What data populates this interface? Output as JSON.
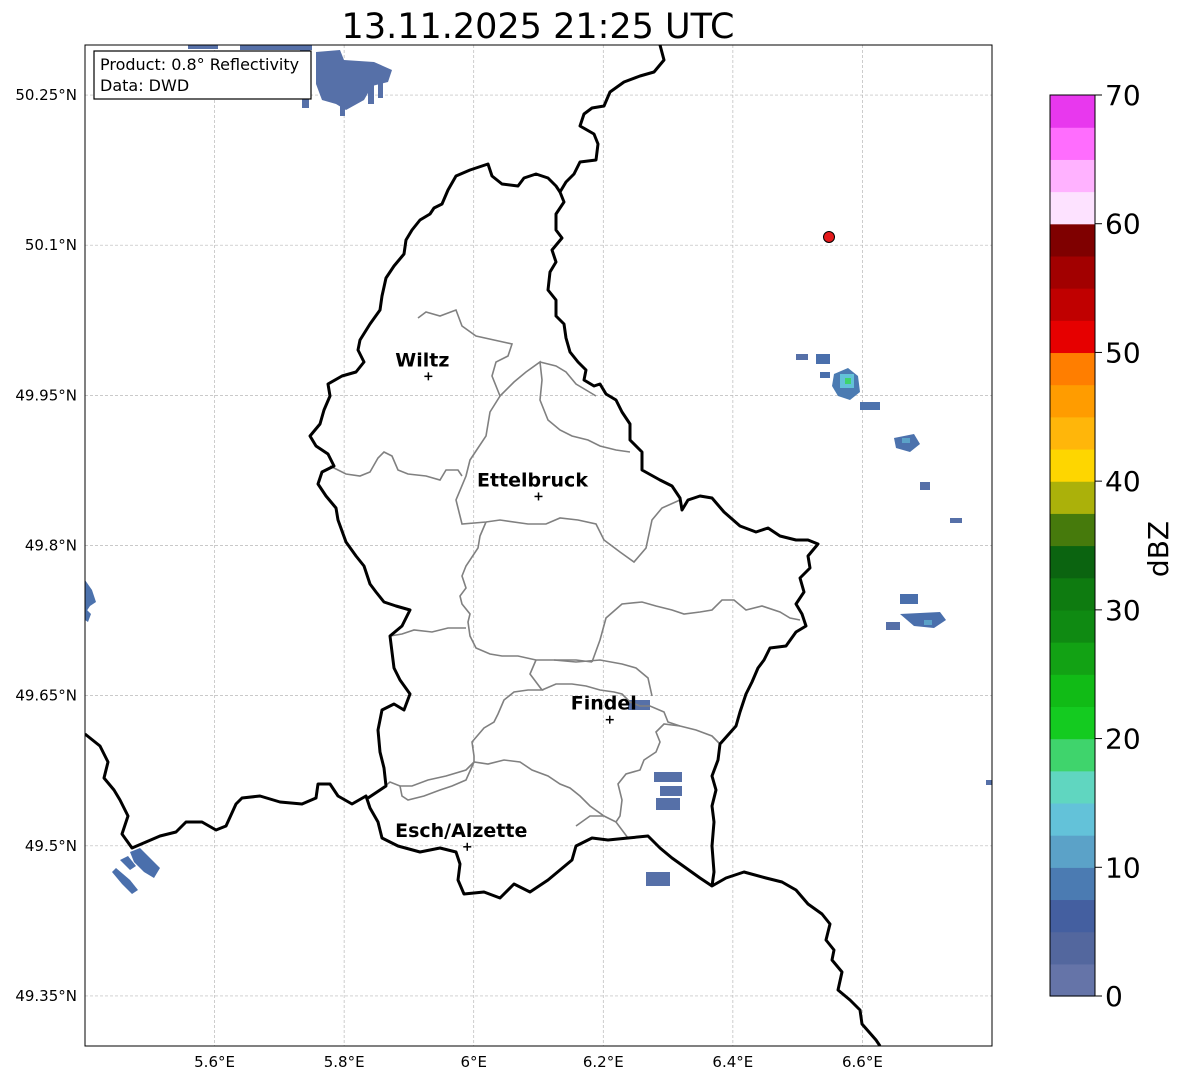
{
  "title": "13.11.2025 21:25 UTC",
  "info_box": {
    "product": "Product: 0.8° Reflectivity",
    "source": "Data: DWD"
  },
  "map": {
    "lon_range": [
      5.4,
      6.8
    ],
    "lat_range": [
      49.3,
      50.3
    ],
    "x_ticks": [
      {
        "value": 5.6,
        "label": "5.6°E"
      },
      {
        "value": 5.8,
        "label": "5.8°E"
      },
      {
        "value": 6.0,
        "label": "6°E"
      },
      {
        "value": 6.2,
        "label": "6.2°E"
      },
      {
        "value": 6.4,
        "label": "6.4°E"
      },
      {
        "value": 6.6,
        "label": "6.6°E"
      }
    ],
    "y_ticks": [
      {
        "value": 50.25,
        "label": "50.25°N"
      },
      {
        "value": 50.1,
        "label": "50.1°N"
      },
      {
        "value": 49.95,
        "label": "49.95°N"
      },
      {
        "value": 49.8,
        "label": "49.8°N"
      },
      {
        "value": 49.65,
        "label": "49.65°N"
      },
      {
        "value": 49.5,
        "label": "49.5°N"
      },
      {
        "value": 49.35,
        "label": "49.35°N"
      }
    ],
    "grid": true,
    "cities": [
      {
        "name": "Wiltz",
        "lon": 5.93,
        "lat": 49.969
      },
      {
        "name": "Ettelbruck",
        "lon": 6.1,
        "lat": 49.849
      },
      {
        "name": "Findel",
        "lon": 6.21,
        "lat": 49.626
      },
      {
        "name": "Esch/Alzette",
        "lon": 5.99,
        "lat": 49.499
      }
    ],
    "radar_site": {
      "lon": 6.548,
      "lat": 50.11,
      "color": "#e41a1c"
    }
  },
  "colorbar": {
    "label": "dBZ",
    "min": 0,
    "max": 70,
    "ticks": [
      "0",
      "10",
      "20",
      "30",
      "40",
      "50",
      "60",
      "70"
    ],
    "colors": [
      "#6574a8",
      "#53679e",
      "#445fa0",
      "#4b7bb2",
      "#5ba2c8",
      "#63c2d9",
      "#60d6c0",
      "#3fd46c",
      "#14cb20",
      "#11bb16",
      "#12a214",
      "#0f8a12",
      "#0e7b10",
      "#0b6410",
      "#467a0c",
      "#abb10a",
      "#fed600",
      "#ffb60a",
      "#ff9c00",
      "#ff7e00",
      "#e60000",
      "#c00000",
      "#a20000",
      "#7f0000",
      "#fde2ff",
      "#ffb2ff",
      "#ff6dfe",
      "#e838ee"
    ]
  }
}
